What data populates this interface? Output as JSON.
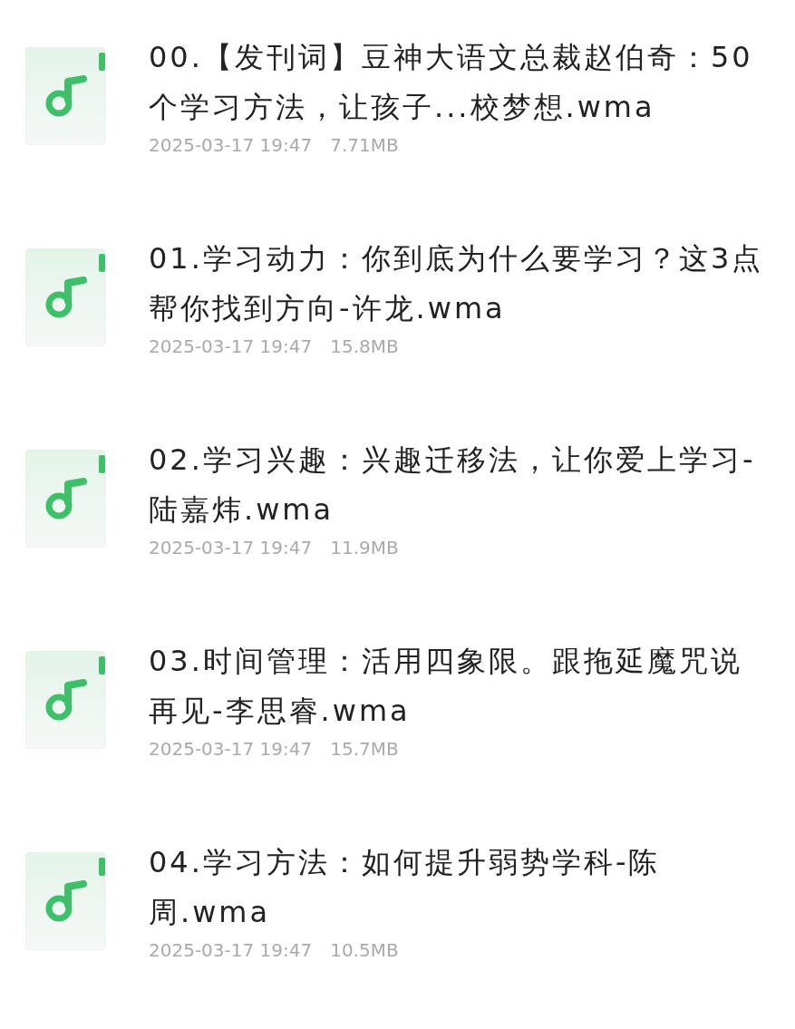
{
  "files": [
    {
      "name": "00.【发刊词】豆神大语文总裁赵伯奇：50个学习方法，让孩子...校梦想.wma",
      "date": "2025-03-17 19:47",
      "size": "7.71MB"
    },
    {
      "name": "01.学习动力：你到底为什么要学习？这3点帮你找到方向-许龙.wma",
      "date": "2025-03-17 19:47",
      "size": "15.8MB"
    },
    {
      "name": "02.学习兴趣：兴趣迁移法，让你爱上学习-陆嘉炜.wma",
      "date": "2025-03-17 19:47",
      "size": "11.9MB"
    },
    {
      "name": "03.时间管理：活用四象限。跟拖延魔咒说再见-李思睿.wma",
      "date": "2025-03-17 19:47",
      "size": "15.7MB"
    },
    {
      "name": "04.学习方法：如何提升弱势学科-陈周.wma",
      "date": "2025-03-17 19:47",
      "size": "10.5MB"
    }
  ]
}
